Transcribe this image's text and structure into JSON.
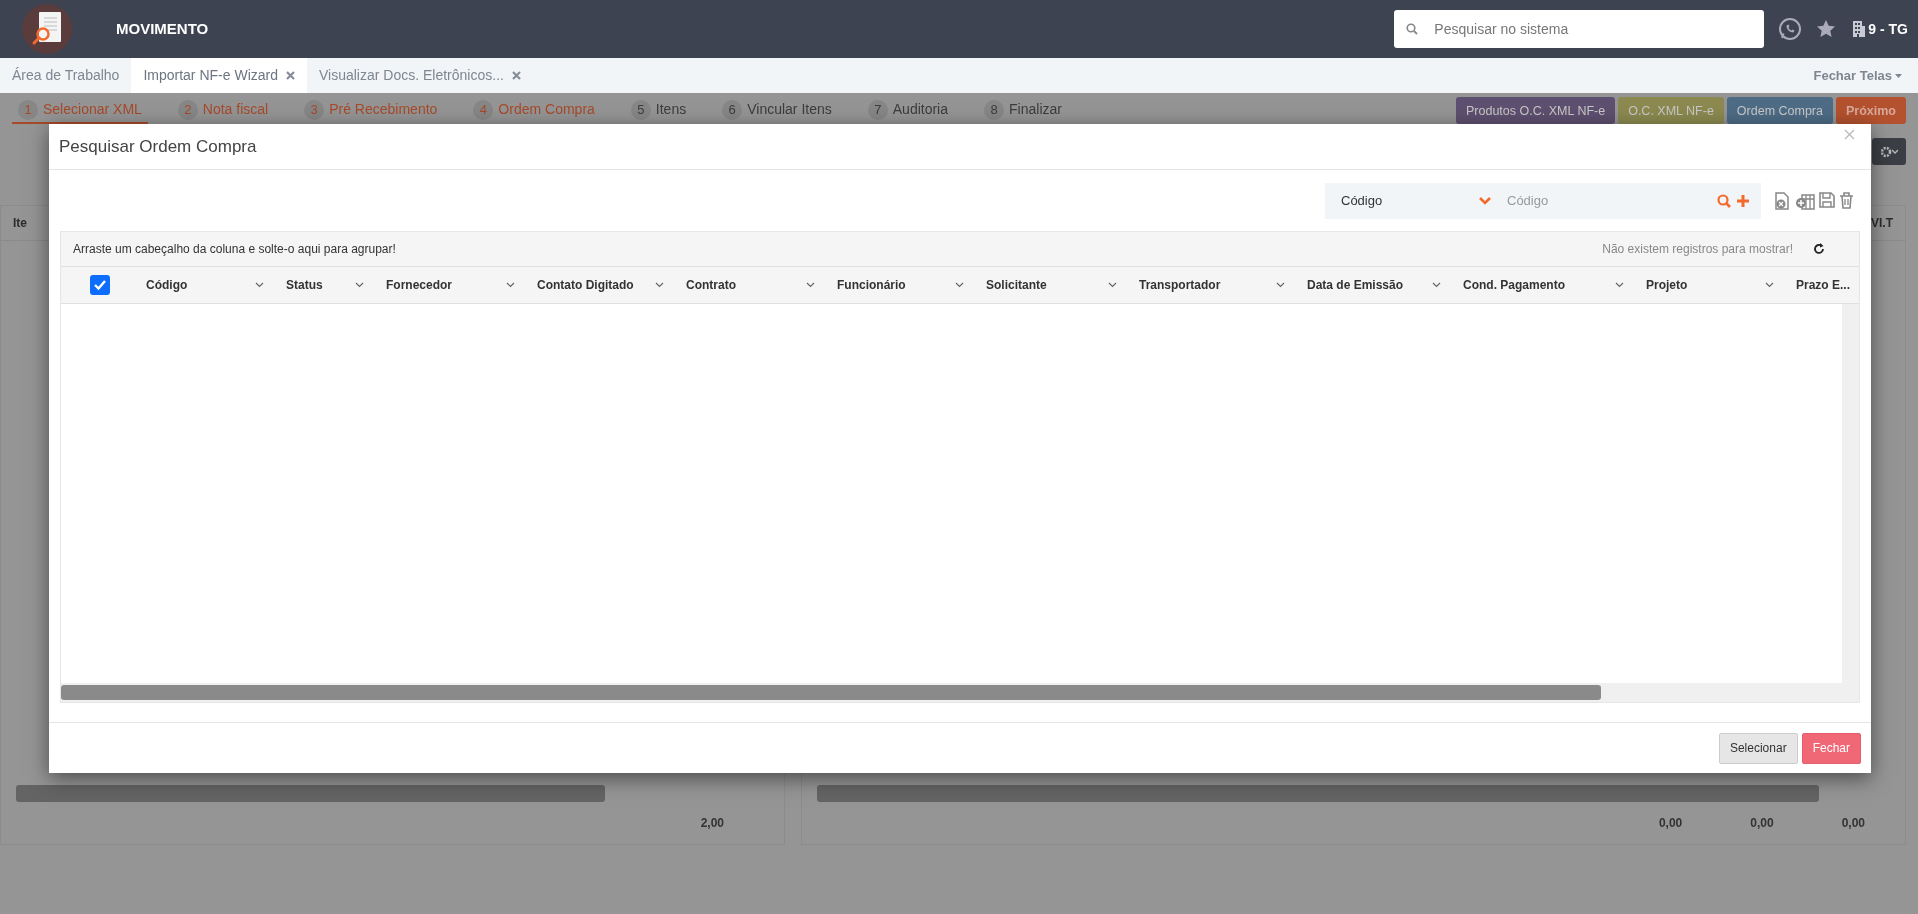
{
  "header": {
    "title": "MOVIMENTO",
    "search": {
      "placeholder": "Pesquisar no sistema"
    },
    "company": "9 - TG"
  },
  "tabs": [
    {
      "label": "Área de Trabalho",
      "selected": false,
      "closable": false
    },
    {
      "label": "Importar NF-e Wizard",
      "selected": true,
      "closable": true
    },
    {
      "label": "Visualizar Docs. Eletrônicos...",
      "selected": false,
      "closable": true
    }
  ],
  "close_tabs": "Fechar Telas",
  "steps": [
    {
      "number": "1",
      "label": "Selecionar XML",
      "done": true,
      "selected": true
    },
    {
      "number": "2",
      "label": "Nota fiscal",
      "done": true,
      "selected": false
    },
    {
      "number": "3",
      "label": "Pré Recebimento",
      "done": true,
      "selected": false
    },
    {
      "number": "4",
      "label": "Ordem Compra",
      "done": true,
      "selected": false
    },
    {
      "number": "5",
      "label": "Itens",
      "done": false,
      "selected": false
    },
    {
      "number": "6",
      "label": "Vincular Itens",
      "done": false,
      "selected": false
    },
    {
      "number": "7",
      "label": "Auditoria",
      "done": false,
      "selected": false
    },
    {
      "number": "8",
      "label": "Finalizar",
      "done": false,
      "selected": false
    }
  ],
  "action_buttons": [
    {
      "label": "Produtos O.C. XML NF-e",
      "color": "#5e5070"
    },
    {
      "label": "O.C. XML NF-e",
      "color": "#8c8a50"
    },
    {
      "label": "Ordem Compra",
      "color": "#4e6c86"
    },
    {
      "label": "Próximo",
      "color": "#b4522f"
    }
  ],
  "background_grid": {
    "column_1": "Ite",
    "column_2": "VI.T",
    "totals": [
      "2,00",
      "0,00",
      "0,00",
      "0,00"
    ]
  },
  "modal": {
    "title": "Pesquisar Ordem Compra",
    "filter": {
      "field": "Código",
      "placeholder": "Código"
    },
    "group_hint": "Arraste um cabeçalho da coluna e solte-o aqui para agrupar!",
    "empty_message": "Não existem registros para mostrar!",
    "select_all": true,
    "columns": [
      "Código",
      "Status",
      "Fornecedor",
      "Contato Digitado",
      "Contrato",
      "Funcionário",
      "Solicitante",
      "Transportador",
      "Data de Emissão",
      "Cond. Pagamento",
      "Projeto",
      "Prazo E..."
    ],
    "buttons": [
      {
        "label": "Selecionar",
        "kind": "secondary"
      },
      {
        "label": "Fechar",
        "kind": "danger"
      }
    ]
  }
}
